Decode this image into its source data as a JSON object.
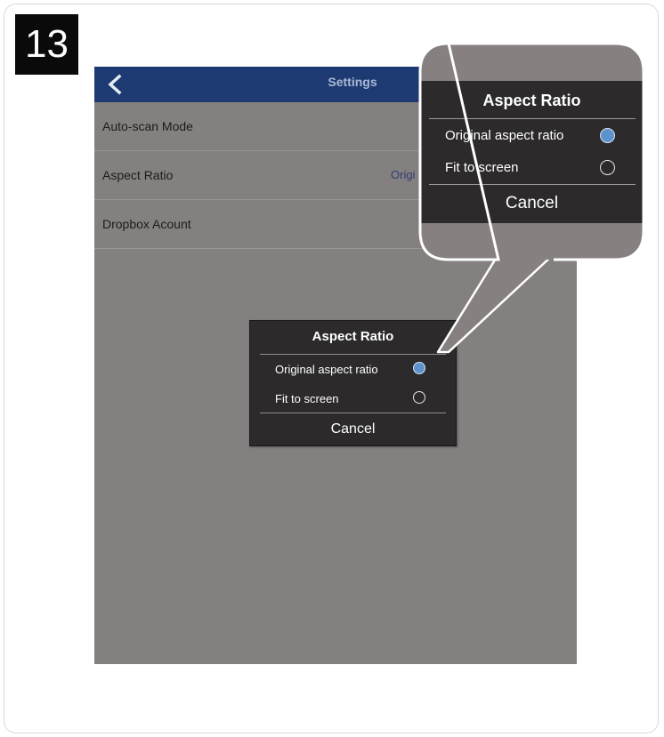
{
  "step": {
    "number": "13"
  },
  "screen": {
    "topbar": {
      "title": "Settings",
      "back_icon": "chevron-left-icon"
    },
    "rows": [
      {
        "label": "Auto-scan Mode",
        "value": ""
      },
      {
        "label": "Aspect Ratio",
        "value": "Origi"
      },
      {
        "label": "Dropbox Acount",
        "value": ""
      }
    ],
    "dialog": {
      "title": "Aspect Ratio",
      "options": [
        {
          "label": "Original aspect ratio",
          "selected": true
        },
        {
          "label": "Fit to screen",
          "selected": false
        }
      ],
      "cancel_label": "Cancel"
    }
  },
  "callout": {
    "title": "Aspect Ratio",
    "options": [
      {
        "label": "Original aspect ratio",
        "selected": true
      },
      {
        "label": "Fit to screen",
        "selected": false
      }
    ],
    "cancel_label": "Cancel"
  },
  "colors": {
    "topbar": "#1d3a72",
    "screen_background": "#858080",
    "dialog_background": "#2c2a2a",
    "radio_selected": "#5e92cd",
    "step_badge": "#0a0a0a"
  }
}
